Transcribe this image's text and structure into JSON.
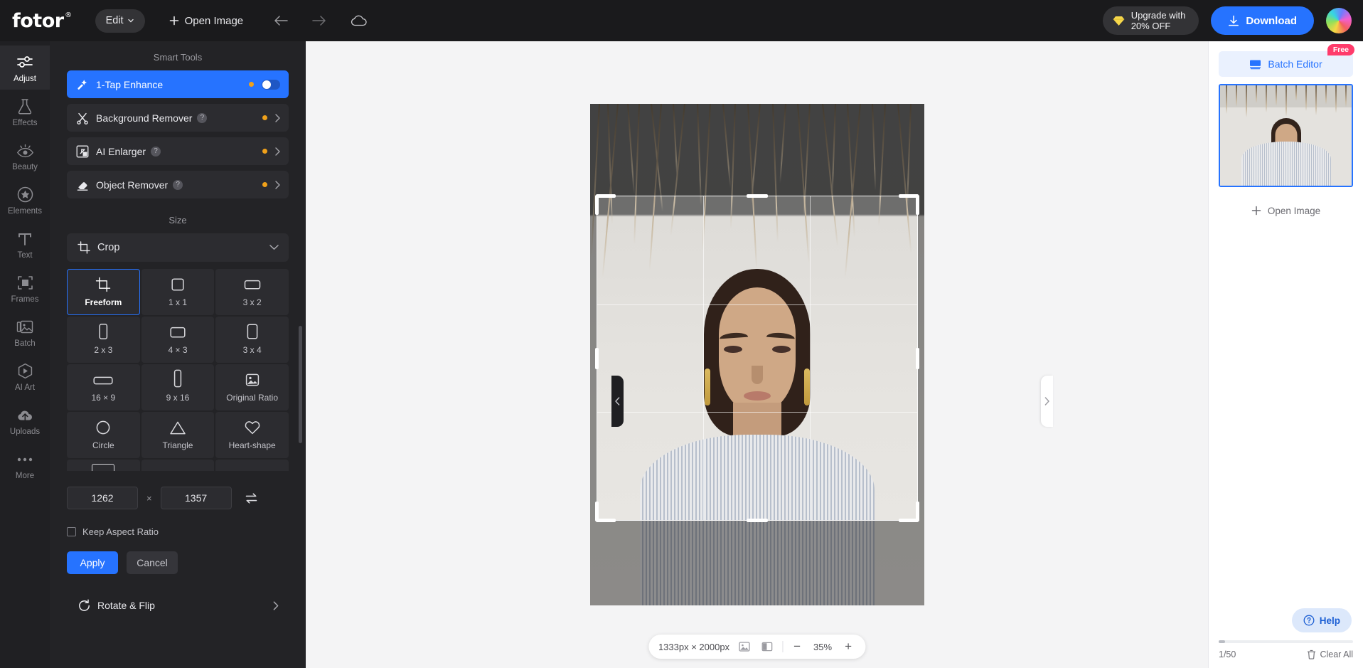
{
  "app": {
    "logo": "fotor",
    "logo_mark": "®"
  },
  "topbar": {
    "edit_label": "Edit",
    "open_image_label": "Open Image",
    "undo_icon": "arrow-left-icon",
    "redo_icon": "arrow-right-icon",
    "cloud_icon": "cloud-icon",
    "upgrade_line1": "Upgrade with",
    "upgrade_line2": "20% OFF",
    "upgrade_icon": "diamond-icon",
    "download_label": "Download",
    "download_icon": "download-icon",
    "avatar_name": "user-avatar"
  },
  "rail": {
    "items": [
      {
        "label": "Adjust",
        "icon": "sliders-icon",
        "active": true
      },
      {
        "label": "Effects",
        "icon": "flask-icon",
        "active": false
      },
      {
        "label": "Beauty",
        "icon": "eye-icon",
        "active": false
      },
      {
        "label": "Elements",
        "icon": "star-badge-icon",
        "active": false
      },
      {
        "label": "Text",
        "icon": "text-t-icon",
        "active": false
      },
      {
        "label": "Frames",
        "icon": "frame-icon",
        "active": false
      },
      {
        "label": "Batch",
        "icon": "batch-icon",
        "active": false
      },
      {
        "label": "AI Art",
        "icon": "ai-art-icon",
        "active": false
      },
      {
        "label": "Uploads",
        "icon": "upload-cloud-icon",
        "active": false
      },
      {
        "label": "More",
        "icon": "more-dots-icon",
        "active": false
      }
    ]
  },
  "panel": {
    "smart_tools_title": "Smart Tools",
    "smart_tools": [
      {
        "label": "1-Tap Enhance",
        "icon": "magic-wand-icon",
        "selected": true,
        "badge": "pro-dot",
        "control": "toggle",
        "has_help": false
      },
      {
        "label": "Background Remover",
        "icon": "scissors-icon",
        "selected": false,
        "badge": "pro-dot",
        "control": "chevron",
        "has_help": true
      },
      {
        "label": "AI Enlarger",
        "icon": "enlarge-icon",
        "selected": false,
        "badge": "pro-dot",
        "control": "chevron",
        "has_help": true
      },
      {
        "label": "Object Remover",
        "icon": "eraser-icon",
        "selected": false,
        "badge": "pro-dot",
        "control": "chevron",
        "has_help": true
      }
    ],
    "size_title": "Size",
    "crop_label": "Crop",
    "crop_icon": "crop-icon",
    "crop_expanded": true,
    "presets": [
      {
        "label": "Freeform",
        "icon": "crop-freeform-icon",
        "selected": true
      },
      {
        "label": "1 x 1",
        "icon": "square-icon",
        "selected": false
      },
      {
        "label": "3 x 2",
        "icon": "landscape-3x2-icon",
        "selected": false
      },
      {
        "label": "2 x 3",
        "icon": "portrait-2x3-icon",
        "selected": false
      },
      {
        "label": "4 × 3",
        "icon": "landscape-4x3-icon",
        "selected": false
      },
      {
        "label": "3 x 4",
        "icon": "portrait-3x4-icon",
        "selected": false
      },
      {
        "label": "16 × 9",
        "icon": "landscape-16x9-icon",
        "selected": false
      },
      {
        "label": "9 x 16",
        "icon": "portrait-9x16-icon",
        "selected": false
      },
      {
        "label": "Original Ratio",
        "icon": "image-icon",
        "selected": false
      },
      {
        "label": "Circle",
        "icon": "circle-icon",
        "selected": false
      },
      {
        "label": "Triangle",
        "icon": "triangle-icon",
        "selected": false
      },
      {
        "label": "Heart-shape",
        "icon": "heart-icon",
        "selected": false
      }
    ],
    "width_value": "1262",
    "height_value": "1357",
    "dim_separator": "×",
    "swap_icon": "swap-arrows-icon",
    "keep_aspect_label": "Keep Aspect Ratio",
    "keep_aspect_checked": false,
    "apply_label": "Apply",
    "cancel_label": "Cancel",
    "rotate_flip_label": "Rotate & Flip",
    "rotate_flip_icon": "rotate-icon"
  },
  "canvas": {
    "collapse_left_icon": "chevron-left-icon",
    "collapse_right_icon": "chevron-right-icon",
    "bottom": {
      "image_size": "1333px × 2000px",
      "fit_icon": "fit-image-icon",
      "compare_icon": "compare-split-icon",
      "zoom_out": "−",
      "zoom_level": "35%",
      "zoom_in": "+"
    }
  },
  "right_panel": {
    "free_badge": "Free",
    "batch_editor_label": "Batch Editor",
    "batch_editor_icon": "batch-layers-icon",
    "open_image_label": "Open Image",
    "count_label": "1/50",
    "clear_all_label": "Clear All",
    "clear_all_icon": "trash-icon",
    "help_label": "Help",
    "help_icon": "question-circle-icon"
  },
  "colors": {
    "accent_blue": "#2673ff",
    "pro_orange": "#f0a11a",
    "free_badge_red": "#ff3b6b",
    "panel_bg": "#232326",
    "rail_bg": "#202023",
    "topbar_bg": "#1a1a1c"
  }
}
